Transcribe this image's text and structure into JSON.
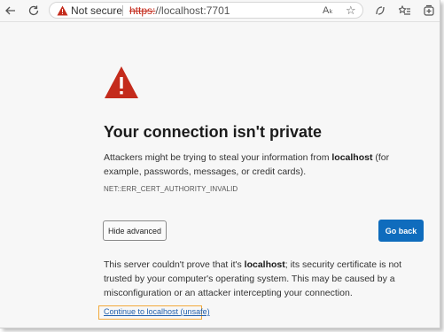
{
  "browser": {
    "security_label": "Not secure",
    "url_scheme": "https:",
    "url_rest": "//localhost:7701",
    "read_aloud": "Aₖ"
  },
  "page": {
    "title": "Your connection isn't private",
    "desc_pre": "Attackers might be trying to steal your information from ",
    "desc_host": "localhost",
    "desc_post": " (for example, passwords, messages, or credit cards).",
    "error_code": "NET::ERR_CERT_AUTHORITY_INVALID",
    "hide_advanced": "Hide advanced",
    "go_back": "Go back",
    "details_pre": "This server couldn't prove that it's ",
    "details_host": "localhost",
    "details_post": "; its security certificate is not trusted by your computer's operating system. This may be caused by a misconfiguration or an attacker intercepting your connection.",
    "continue_link": "Continue to localhost (unsafe)"
  },
  "colors": {
    "warning_red": "#c42b1c",
    "primary_button": "#0f6cbd",
    "link": "#1f5fae",
    "highlight": "#f2a93b"
  }
}
